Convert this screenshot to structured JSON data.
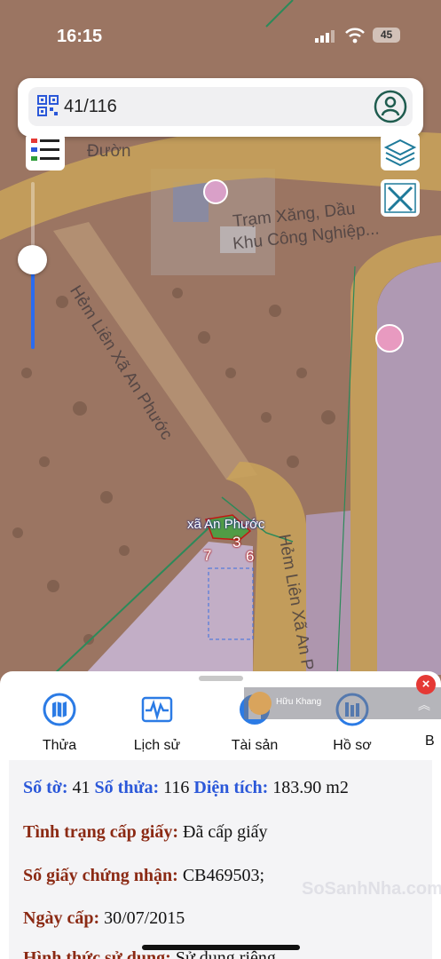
{
  "status_bar": {
    "time": "16:15",
    "battery": "45"
  },
  "search": {
    "value": "41/116"
  },
  "map": {
    "road_labels": [
      "Đườn",
      "Hẻm Liên Xã An Phước",
      "Hẻm Liên Xã An P"
    ],
    "poi": {
      "line1": "Trạm Xăng, Dầu",
      "line2": "Khu Công Nghiệp..."
    },
    "parcel_label": "xã An Phước",
    "vertex_labels": [
      "7",
      "3",
      "6"
    ],
    "zoom_level": 0.47
  },
  "tabs": [
    {
      "label": "Thửa",
      "icon": "map-icon"
    },
    {
      "label": "Lịch sử",
      "icon": "activity-icon"
    },
    {
      "label": "Tài sản",
      "icon": "building-icon"
    },
    {
      "label": "Hồ sơ",
      "icon": "folder-icon"
    },
    {
      "label": "B",
      "icon": "more-icon"
    }
  ],
  "info": {
    "so_to_label": "Số tờ:",
    "so_to": "41",
    "so_thua_label": "Số thửa:",
    "so_thua": "116",
    "dien_tich_label": "Diện tích:",
    "dien_tich": "183.90 m2",
    "tinh_trang_label": "Tình trạng cấp giấy:",
    "tinh_trang": "Đã cấp giấy",
    "so_gcn_label": "Số giấy chứng nhận:",
    "so_gcn": "CB469503;",
    "ngay_cap_label": "Ngày cấp:",
    "ngay_cap": "30/07/2015",
    "hinh_thuc_label": "Hình thức sử dụng:",
    "hinh_thuc": "Sử dụng riêng"
  },
  "chat": {
    "name": "Hữu Khang"
  },
  "watermark": "SoSanhNha.com",
  "colors": {
    "accent": "#2b58d9",
    "label_red": "#8b2a14",
    "road": "#c9a35a",
    "parcel": "#c9b8d8"
  }
}
